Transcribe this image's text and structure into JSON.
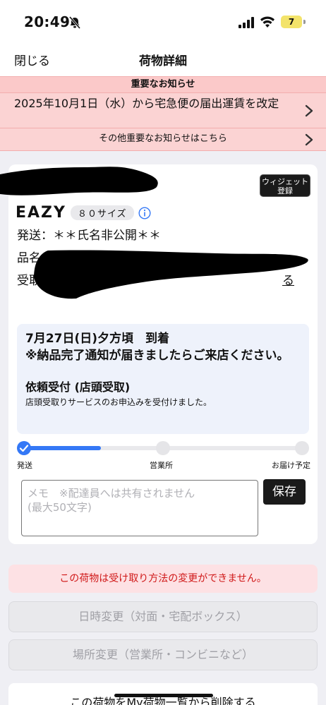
{
  "status": {
    "time": "20:49",
    "battery": "7"
  },
  "nav": {
    "close": "閉じる",
    "title": "荷物詳細"
  },
  "notice": {
    "header": "重要なお知らせ",
    "main": "2025年10月1日（水）から宅急便の届出運賃を改定",
    "other": "その他重要なお知らせはこちら"
  },
  "card": {
    "widget_label": "ウィジェット登録",
    "brand": "EAZY",
    "size": "８０サイズ",
    "sender_label": "発送：",
    "sender_value": "＊＊氏名非公開＊＊",
    "item_label": "品名：",
    "recv_label": "受取",
    "recv_link": "る",
    "arrival_date": "7月27日(日)夕方頃　到着",
    "arrival_note": "※納品完了通知が届きましたらご来店ください。",
    "request_title": "依頼受付 (店頭受取)",
    "request_desc": "店頭受取りサービスのお申込みを受付けました。",
    "progress": {
      "steps": [
        "発送",
        "営業所",
        "お届け予定"
      ],
      "fill_fraction": 0.25
    },
    "memo_placeholder": "メモ　※配達員へは共有されません\n(最大50文字)",
    "save": "保存"
  },
  "warning": "この荷物は受け取り方法の変更ができません。",
  "buttons": {
    "date_change": "日時変更（対面・宅配ボックス）",
    "place_change": "場所変更（営業所・コンビニなど）",
    "delete": "この荷物をMy荷物一覧から削除する"
  },
  "colors": {
    "accent": "#3478f6",
    "notice_bg": "#fbd3d3",
    "warning_text": "#d01818"
  }
}
